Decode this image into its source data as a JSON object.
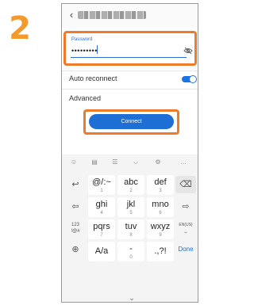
{
  "step": "2",
  "header": {
    "network_name": "▪▪▪▪▪▪▪▪▪"
  },
  "password": {
    "label": "Password",
    "value": "•••••••••"
  },
  "settings": {
    "auto_reconnect_label": "Auto reconnect",
    "auto_reconnect_on": true,
    "advanced_label": "Advanced"
  },
  "connect_label": "Connect",
  "keyboard": {
    "toolbar": [
      "☺",
      "▤",
      "☰",
      "⌵",
      "⚙",
      "…"
    ],
    "rows": [
      [
        {
          "main": "@/:~",
          "sub": "1"
        },
        {
          "main": "abc",
          "sub": "2"
        },
        {
          "main": "def",
          "sub": "3"
        }
      ],
      [
        {
          "main": "ghi",
          "sub": "4"
        },
        {
          "main": "jkl",
          "sub": "5"
        },
        {
          "main": "mno",
          "sub": "6"
        }
      ],
      [
        {
          "main": "pqrs",
          "sub": "7"
        },
        {
          "main": "tuv",
          "sub": "8"
        },
        {
          "main": "wxyz",
          "sub": "9"
        }
      ],
      [
        {
          "main": "A/a",
          "sub": ""
        },
        {
          "main": "-",
          "sub": "0"
        },
        {
          "main": ".,?!",
          "sub": ""
        }
      ]
    ],
    "left_keys": [
      "↩",
      "⇦",
      "123\n!@#",
      "⊕"
    ],
    "right_keys": [
      "⌫",
      "⇨",
      "EN(US)\n␣",
      "Done"
    ]
  },
  "colors": {
    "accent_orange": "#ee7a2a",
    "primary_blue": "#1d6fd6"
  }
}
